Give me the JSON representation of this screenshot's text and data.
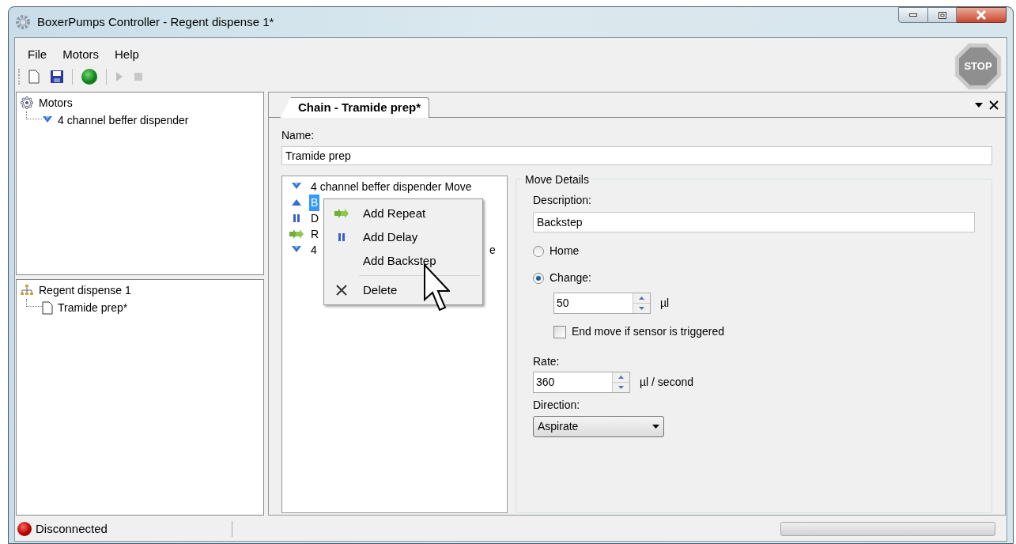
{
  "window": {
    "title": "BoxerPumps Controller - Regent dispense 1*"
  },
  "menu": [
    "File",
    "Motors",
    "Help"
  ],
  "toolbar": [
    {
      "kind": "new",
      "disabled": false
    },
    {
      "kind": "save",
      "disabled": false
    },
    {
      "kind": "connect",
      "disabled": false
    },
    {
      "kind": "play",
      "disabled": true
    },
    {
      "kind": "stop",
      "disabled": true
    }
  ],
  "stop_button": "STOP",
  "motors_tree": {
    "label": "Motors",
    "children": [
      {
        "label": "4 channel beffer dispender"
      }
    ]
  },
  "project_tree": {
    "label": "Regent dispense 1",
    "children": [
      {
        "label": "Tramide prep*"
      }
    ]
  },
  "tabs": [
    {
      "label": "Chain - Tramide prep*",
      "selected": true
    }
  ],
  "name_label": "Name:",
  "name_value": "Tramide prep",
  "chain": [
    {
      "kind": "move-down",
      "text": "4 channel beffer dispender Move",
      "selected": false
    },
    {
      "kind": "move-up",
      "text": "B",
      "selected": true
    },
    {
      "kind": "delay",
      "text": "D",
      "selected": false
    },
    {
      "kind": "repeat",
      "text": "R",
      "selected": false
    },
    {
      "kind": "move-down",
      "text": "4",
      "tail": "e",
      "selected": false
    }
  ],
  "context_menu": [
    {
      "kind": "repeat",
      "label": "Add Repeat"
    },
    {
      "kind": "delay",
      "label": "Add Delay"
    },
    {
      "kind": "none",
      "label": "Add Backstep"
    },
    {
      "kind": "separator"
    },
    {
      "kind": "delete",
      "label": "Delete"
    }
  ],
  "move_details": {
    "title": "Move Details",
    "description_label": "Description:",
    "description": "Backstep",
    "options": [
      {
        "label": "Home",
        "selected": false
      },
      {
        "label": "Change:",
        "selected": true
      }
    ],
    "change_value": "50",
    "change_unit": "µl",
    "end_move": {
      "label": "End move if sensor is triggered",
      "checked": false
    },
    "rate_label": "Rate:",
    "rate_value": "360",
    "rate_unit": "µl / second",
    "direction_label": "Direction:",
    "direction": "Aspirate"
  },
  "status_bar": {
    "text": "Disconnected",
    "progress": {
      "level": 0
    }
  }
}
